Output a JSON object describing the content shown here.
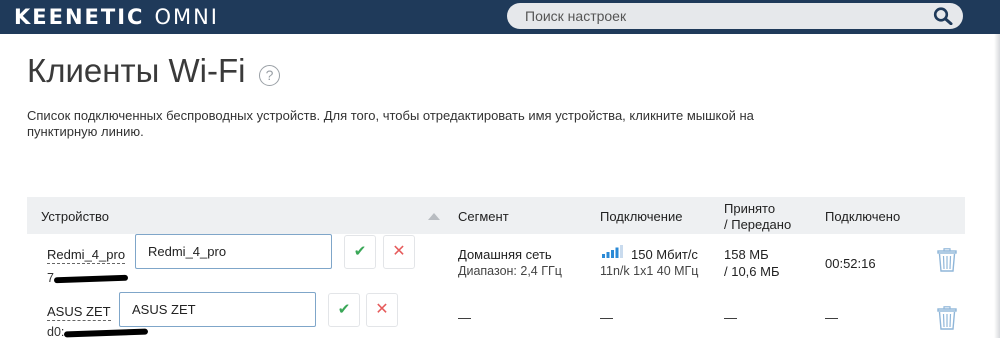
{
  "header": {
    "brand_bold": "KEENETIC",
    "brand_light": "OMNI",
    "search_placeholder": "Поиск настроек",
    "search_icon": "search-icon"
  },
  "page": {
    "title": "Клиенты Wi-Fi",
    "help_glyph": "?",
    "description": "Список подключенных беспроводных устройств. Для того, чтобы отредактировать имя устройства, кликните мышкой на пунктирную линию."
  },
  "table": {
    "columns": {
      "device": "Устройство",
      "segment": "Сегмент",
      "connection": "Подключение",
      "received_1": "Принято",
      "received_2": "/ Передано",
      "connected": "Подключено"
    },
    "rows": [
      {
        "name": "Redmi_4_pro",
        "mac_prefix": "7",
        "input_value": "Redmi_4_pro",
        "segment": "Домашняя сеть",
        "band": "Диапазон: 2,4 ГГц",
        "speed": "150 Мбит/с",
        "mode": "11n/k 1x1 40 МГц",
        "received": "158 МБ",
        "sent": "/ 10,6 МБ",
        "uptime": "00:52:16",
        "signal_level": 0.75
      },
      {
        "name": "ASUS ZET",
        "mac_prefix": "d0:",
        "input_value": "ASUS ZET",
        "segment": "—",
        "connection": "—",
        "traffic": "—",
        "uptime": "—"
      }
    ],
    "ok_glyph": "✔",
    "cancel_glyph": "✕"
  },
  "colors": {
    "topbar": "#1f3a5a",
    "accent_blue": "#2b8ad6",
    "ok_green": "#3aa757",
    "cancel_red": "#e65b5b",
    "trash": "#8fb6d9"
  }
}
